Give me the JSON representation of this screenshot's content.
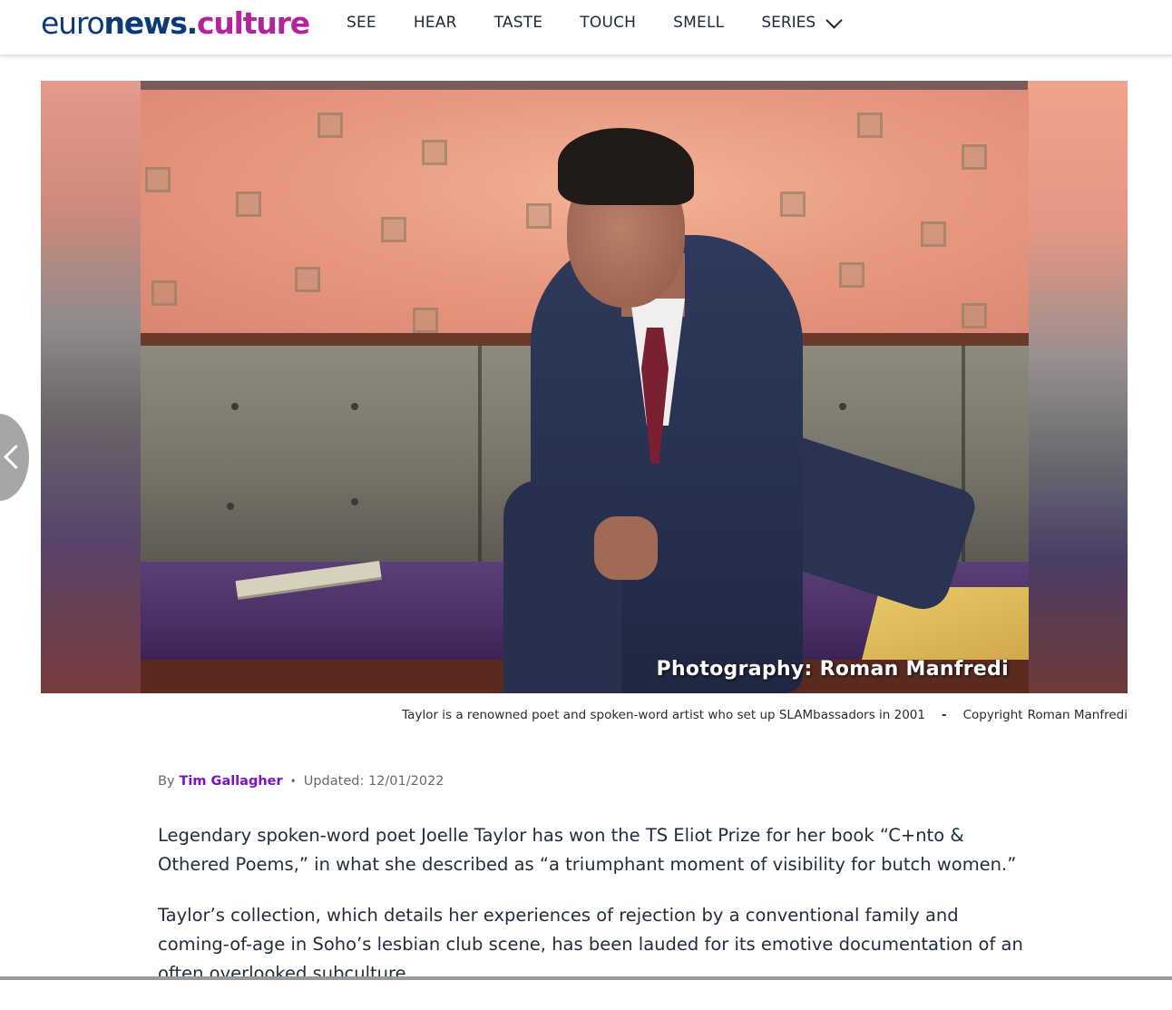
{
  "header": {
    "logo": {
      "euro": "euro",
      "news": "news",
      "dot": ".",
      "culture": "culture"
    },
    "nav": [
      {
        "label": "SEE"
      },
      {
        "label": "HEAR"
      },
      {
        "label": "TASTE"
      },
      {
        "label": "TOUCH"
      },
      {
        "label": "SMELL"
      },
      {
        "label": "SERIES"
      }
    ]
  },
  "hero": {
    "photo_credit_overlay": "Photography: Roman Manfredi",
    "caption": "Taylor is a renowned poet and spoken-word artist who set up SLAMbassadors in 2001",
    "caption_separator": "-",
    "copyright_label": "Copyright",
    "copyright_holder": "Roman Manfredi"
  },
  "byline": {
    "by": "By",
    "author": "Tim Gallagher",
    "bullet": "•",
    "updated": "Updated: 12/01/2022"
  },
  "article": {
    "paragraphs": [
      "Legendary spoken-word poet Joelle Taylor has won the TS Eliot Prize for her book “C+nto & Othered Poems,” in what she described as “a triumphant moment of visibility for butch women.”",
      "Taylor’s collection, which details her experiences of rejection by a conventional family and coming-of-age in Soho’s lesbian club scene, has been lauded for its emotive documentation of an often overlooked subculture."
    ]
  },
  "colors": {
    "brand_blue": "#0b3a78",
    "brand_magenta": "#b3239a",
    "author_link": "#7a12c9"
  }
}
